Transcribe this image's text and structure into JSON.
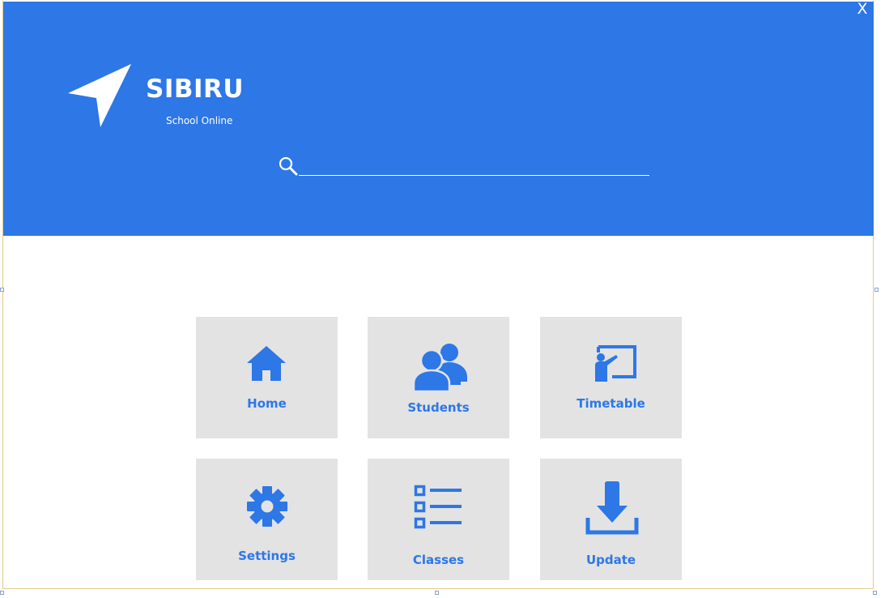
{
  "window": {
    "close_label": "X"
  },
  "header": {
    "app_name": "SIBIRU",
    "tagline": "School Online",
    "logo_icon": "navigation-arrow-icon",
    "search": {
      "icon": "search-icon",
      "value": "",
      "placeholder": ""
    }
  },
  "menu": {
    "tiles": [
      {
        "id": "home",
        "label": "Home",
        "icon": "home-icon"
      },
      {
        "id": "students",
        "label": "Students",
        "icon": "users-icon"
      },
      {
        "id": "timetable",
        "label": "Timetable",
        "icon": "teacher-board-icon"
      },
      {
        "id": "settings",
        "label": "Settings",
        "icon": "gear-icon"
      },
      {
        "id": "classes",
        "label": "Classes",
        "icon": "list-icon"
      },
      {
        "id": "update",
        "label": "Update",
        "icon": "download-icon"
      }
    ]
  },
  "colors": {
    "brand": "#2d77e6",
    "tile_bg": "#e3e3e3",
    "text_on_brand": "#ffffff"
  }
}
